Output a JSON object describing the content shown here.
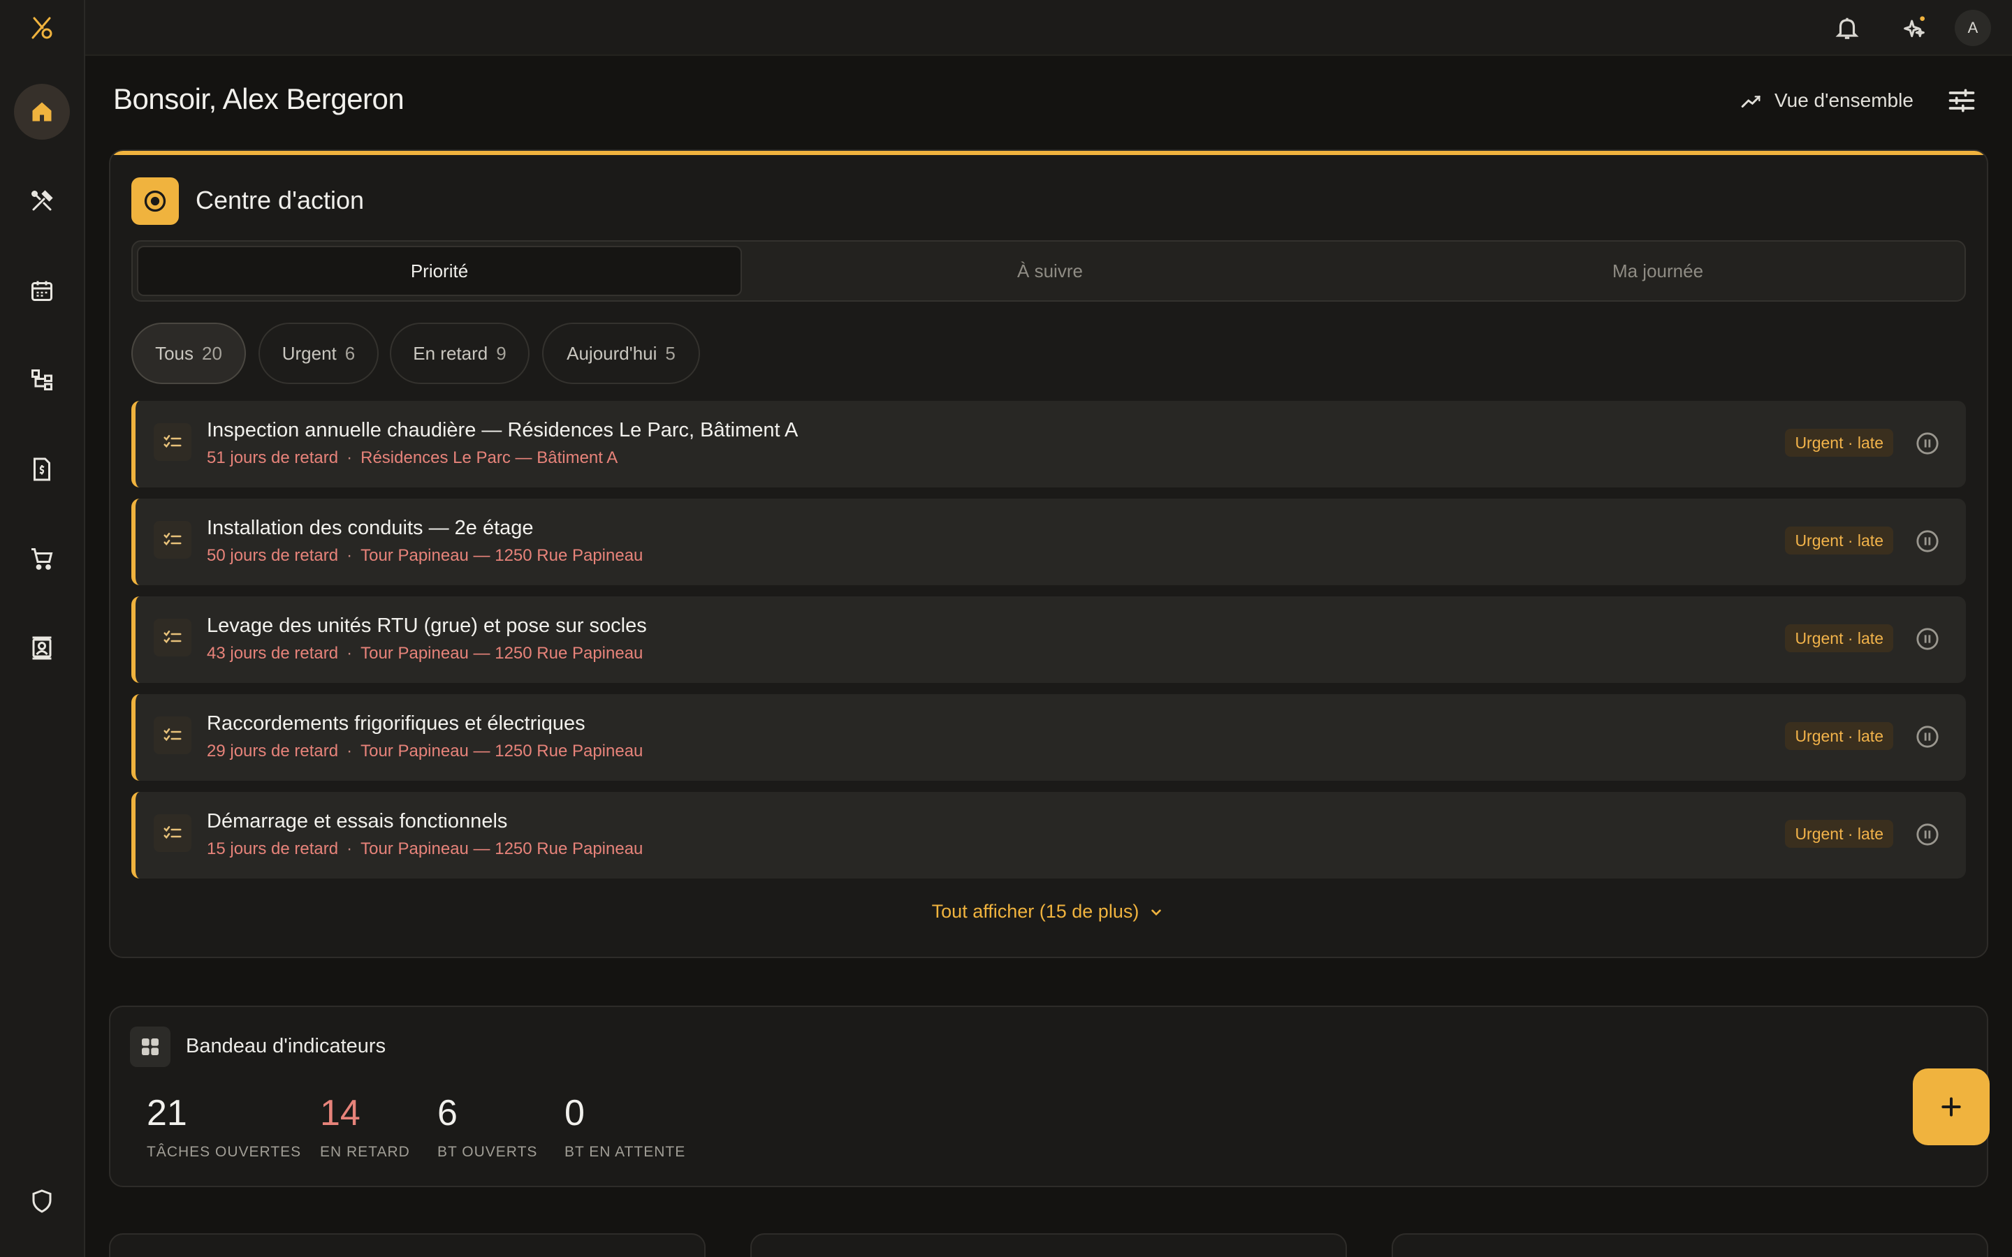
{
  "colors": {
    "accent": "#f0b33e",
    "late_text": "#e7837a",
    "badge_bg": "#3a2f1e",
    "background": "#141311"
  },
  "sidebar": {
    "items": [
      {
        "name": "home",
        "icon": "home-icon",
        "active": true
      },
      {
        "name": "tools",
        "icon": "tools-icon"
      },
      {
        "name": "calendar",
        "icon": "calendar-icon"
      },
      {
        "name": "hierarchy",
        "icon": "hierarchy-icon"
      },
      {
        "name": "invoice",
        "icon": "invoice-icon"
      },
      {
        "name": "cart",
        "icon": "cart-icon"
      },
      {
        "name": "contacts",
        "icon": "contacts-icon"
      },
      {
        "name": "security",
        "icon": "shield-icon"
      }
    ]
  },
  "topbar": {
    "avatar_initial": "A",
    "icons": [
      "bell-icon",
      "sparkles-icon"
    ]
  },
  "header": {
    "greeting": "Bonsoir, Alex Bergeron",
    "overview_label": "Vue d'ensemble"
  },
  "action_center": {
    "title": "Centre d'action",
    "tabs": [
      {
        "label": "Priorité",
        "active": true
      },
      {
        "label": "À suivre"
      },
      {
        "label": "Ma journée"
      }
    ],
    "filters": [
      {
        "label": "Tous",
        "count": "20",
        "active": true
      },
      {
        "label": "Urgent",
        "count": "6"
      },
      {
        "label": "En retard",
        "count": "9"
      },
      {
        "label": "Aujourd'hui",
        "count": "5"
      }
    ],
    "tasks": [
      {
        "title": "Inspection annuelle chaudière — Résidences Le Parc, Bâtiment A",
        "late": "51 jours de retard",
        "location": "Résidences Le Parc — Bâtiment A",
        "badge": "Urgent · late"
      },
      {
        "title": "Installation des conduits — 2e étage",
        "late": "50 jours de retard",
        "location": "Tour Papineau — 1250 Rue Papineau",
        "badge": "Urgent · late"
      },
      {
        "title": "Levage des unités RTU (grue) et pose sur socles",
        "late": "43 jours de retard",
        "location": "Tour Papineau — 1250 Rue Papineau",
        "badge": "Urgent · late"
      },
      {
        "title": "Raccordements frigorifiques et électriques",
        "late": "29 jours de retard",
        "location": "Tour Papineau — 1250 Rue Papineau",
        "badge": "Urgent · late"
      },
      {
        "title": "Démarrage et essais fonctionnels",
        "late": "15 jours de retard",
        "location": "Tour Papineau — 1250 Rue Papineau",
        "badge": "Urgent · late"
      }
    ],
    "show_all": "Tout afficher (15 de plus)"
  },
  "kpi_banner": {
    "title": "Bandeau d'indicateurs",
    "items": [
      {
        "value": "21",
        "label": "TÂCHES OUVERTES"
      },
      {
        "value": "14",
        "label": "EN RETARD",
        "highlight": true
      },
      {
        "value": "6",
        "label": "BT OUVERTS"
      },
      {
        "value": "0",
        "label": "BT EN ATTENTE"
      }
    ]
  },
  "fab_label": "+"
}
